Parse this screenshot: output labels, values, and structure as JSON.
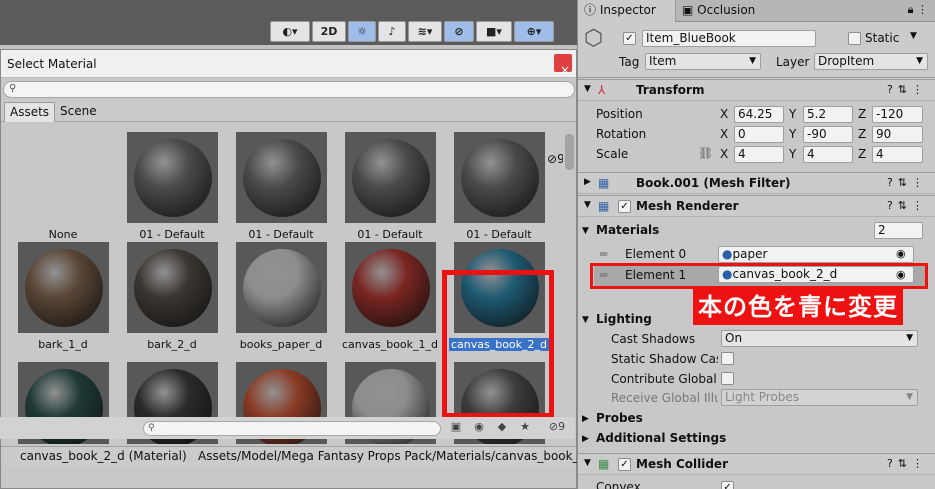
{
  "scene_toolbar": {
    "toggle_2d": "2D"
  },
  "dialog": {
    "title": "Select Material",
    "close_glyph": "×",
    "tabs": [
      "Assets",
      "Scene"
    ],
    "hidden_count": "9",
    "grid": [
      {
        "label": "None",
        "color": "none"
      },
      {
        "label": "01 - Default",
        "color": "#4a4a4a"
      },
      {
        "label": "01 - Default",
        "color": "#4a4a4a"
      },
      {
        "label": "01 - Default",
        "color": "#4a4a4a"
      },
      {
        "label": "01 - Default",
        "color": "#4a4a4a"
      },
      {
        "label": "bark_1_d",
        "color": "#5a4636"
      },
      {
        "label": "bark_2_d",
        "color": "#3b3631"
      },
      {
        "label": "books_paper_d",
        "color": "#8d8d8d"
      },
      {
        "label": "canvas_book_1_d",
        "color": "#7a2622"
      },
      {
        "label": "canvas_book_2_d",
        "color": "#1e5a73"
      },
      {
        "label": "",
        "color": "#1f3a36"
      },
      {
        "label": "",
        "color": "#2a2a2a"
      },
      {
        "label": "",
        "color": "#8a3a24"
      },
      {
        "label": "",
        "color": "#8c8c8c"
      },
      {
        "label": "",
        "color": "#3c3c3c"
      }
    ],
    "status_left": "canvas_book_2_d (Material)",
    "status_path": "Assets/Model/Mega Fantasy Props Pack/Materials/canvas_book_2",
    "bottom_count": "9"
  },
  "inspector": {
    "tabs": [
      "Inspector",
      "Occlusion"
    ],
    "object": {
      "name": "Item_BlueBook",
      "static_label": "Static",
      "tag_label": "Tag",
      "tag_value": "Item",
      "layer_label": "Layer",
      "layer_value": "DropItem"
    },
    "transform": {
      "title": "Transform",
      "position": {
        "label": "Position",
        "x": "64.25",
        "y": "5.2",
        "z": "-120"
      },
      "rotation": {
        "label": "Rotation",
        "x": "0",
        "y": "-90",
        "z": "90"
      },
      "scale": {
        "label": "Scale",
        "x": "4",
        "y": "4",
        "z": "4"
      },
      "axis_x": "X",
      "axis_y": "Y",
      "axis_z": "Z"
    },
    "mesh_filter": {
      "title": "Book.001 (Mesh Filter)"
    },
    "mesh_renderer": {
      "title": "Mesh Renderer",
      "materials_label": "Materials",
      "materials_count": "2",
      "element0_label": "Element 0",
      "element0_value": "paper",
      "element1_label": "Element 1",
      "element1_value": "canvas_book_2_d",
      "lighting_label": "Lighting",
      "cast_shadows_label": "Cast Shadows",
      "cast_shadows_value": "On",
      "static_shadow_label": "Static Shadow Cas",
      "contribute_gi_label": "Contribute Global I",
      "receive_gi_label": "Receive Global Illu",
      "receive_gi_value": "Light Probes",
      "probes_label": "Probes",
      "additional_label": "Additional Settings"
    },
    "mesh_collider": {
      "title": "Mesh Collider",
      "convex_label": "Convex"
    }
  },
  "annotation": "本の色を青に変更"
}
